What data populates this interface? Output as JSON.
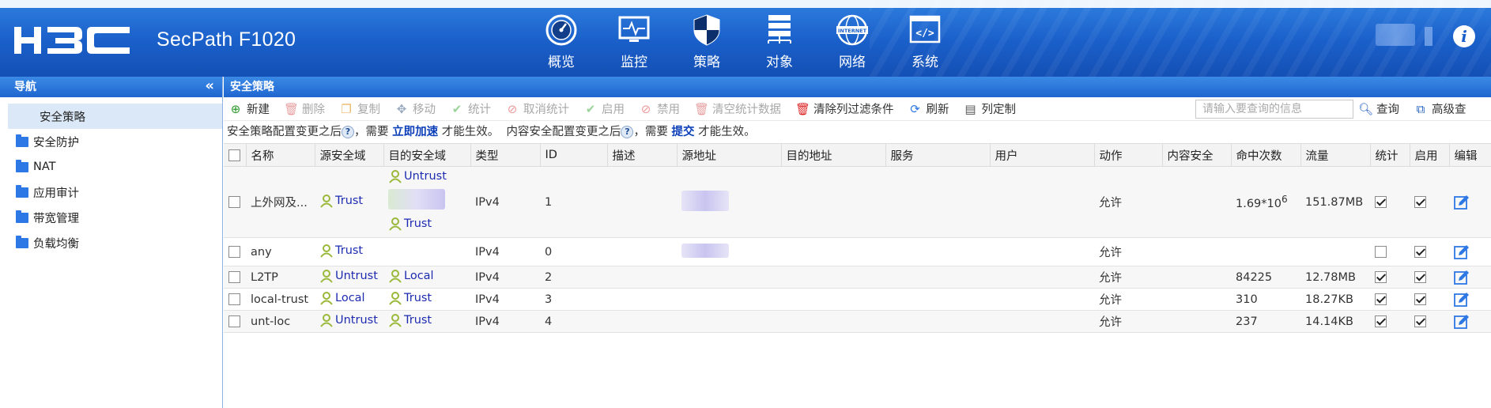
{
  "header": {
    "product": "SecPath F1020",
    "nav": [
      {
        "label": "概览",
        "icon": "gauge-icon"
      },
      {
        "label": "监控",
        "icon": "monitor-icon"
      },
      {
        "label": "策略",
        "icon": "shield-icon"
      },
      {
        "label": "对象",
        "icon": "object-list-icon"
      },
      {
        "label": "网络",
        "icon": "internet-globe-icon"
      },
      {
        "label": "系统",
        "icon": "code-window-icon"
      }
    ]
  },
  "sidebar": {
    "title": "导航",
    "collapse": "«",
    "items": [
      {
        "label": "安全策略",
        "active": true
      },
      {
        "label": "安全防护"
      },
      {
        "label": "NAT"
      },
      {
        "label": "应用审计"
      },
      {
        "label": "带宽管理"
      },
      {
        "label": "负载均衡"
      }
    ]
  },
  "main": {
    "title": "安全策略",
    "toolbar": [
      {
        "label": "新建",
        "icon": "plus-circle-icon",
        "enabled": true
      },
      {
        "label": "删除",
        "icon": "trash-icon",
        "enabled": false
      },
      {
        "label": "复制",
        "icon": "copy-icon",
        "enabled": false
      },
      {
        "label": "移动",
        "icon": "move-icon",
        "enabled": false
      },
      {
        "label": "统计",
        "icon": "check-circle-icon",
        "enabled": false
      },
      {
        "label": "取消统计",
        "icon": "no-entry-icon",
        "enabled": false
      },
      {
        "label": "启用",
        "icon": "check-circle-icon",
        "enabled": false
      },
      {
        "label": "禁用",
        "icon": "no-entry-icon",
        "enabled": false
      },
      {
        "label": "清空统计数据",
        "icon": "clear-trash-icon",
        "enabled": false
      },
      {
        "label": "清除列过滤条件",
        "icon": "clear-filter-icon",
        "enabled": true
      },
      {
        "label": "刷新",
        "icon": "refresh-icon",
        "enabled": true
      },
      {
        "label": "列定制",
        "icon": "columns-icon",
        "enabled": true
      }
    ],
    "search_placeholder": "请输入要查询的信息",
    "search_button": "查询",
    "advanced_search": "高级查",
    "notice": {
      "part1": "安全策略配置变更之后",
      "part2": "，需要",
      "link1": "立即加速",
      "part3": "才能生效。",
      "part4": "内容安全配置变更之后",
      "part5": "，需要",
      "link2": "提交",
      "part6": "才能生效。"
    },
    "columns": [
      "名称",
      "源安全域",
      "目的安全域",
      "类型",
      "ID",
      "描述",
      "源地址",
      "目的地址",
      "服务",
      "用户",
      "动作",
      "内容安全",
      "命中次数",
      "流量",
      "统计",
      "启用",
      "编辑"
    ],
    "rows": [
      {
        "name": "上外网及...",
        "src_zone": "Trust",
        "dst_zones": [
          "Untrust",
          "Trust"
        ],
        "type": "IPv4",
        "id": "0",
        "id_display": "1",
        "action": "允许",
        "hits_base": "1.69*10",
        "hits_exp": "6",
        "traffic": "151.87MB",
        "stat": true,
        "enable": true
      },
      {
        "name": "any",
        "src_zone": "Trust",
        "dst_zones": [],
        "type": "IPv4",
        "id_display": "0",
        "action": "允许",
        "hits": "",
        "traffic": "",
        "stat": false,
        "enable": true
      },
      {
        "name": "L2TP",
        "src_zone": "Untrust",
        "dst_zones": [
          "Local"
        ],
        "type": "IPv4",
        "id_display": "2",
        "action": "允许",
        "hits": "84225",
        "traffic": "12.78MB",
        "stat": true,
        "enable": true
      },
      {
        "name": "local-trust",
        "src_zone": "Local",
        "dst_zones": [
          "Trust"
        ],
        "type": "IPv4",
        "id_display": "3",
        "action": "允许",
        "hits": "310",
        "traffic": "18.27KB",
        "stat": true,
        "enable": true
      },
      {
        "name": "unt-loc",
        "src_zone": "Untrust",
        "dst_zones": [
          "Trust"
        ],
        "type": "IPv4",
        "id_display": "4",
        "action": "允许",
        "hits": "237",
        "traffic": "14.14KB",
        "stat": true,
        "enable": true
      }
    ]
  }
}
